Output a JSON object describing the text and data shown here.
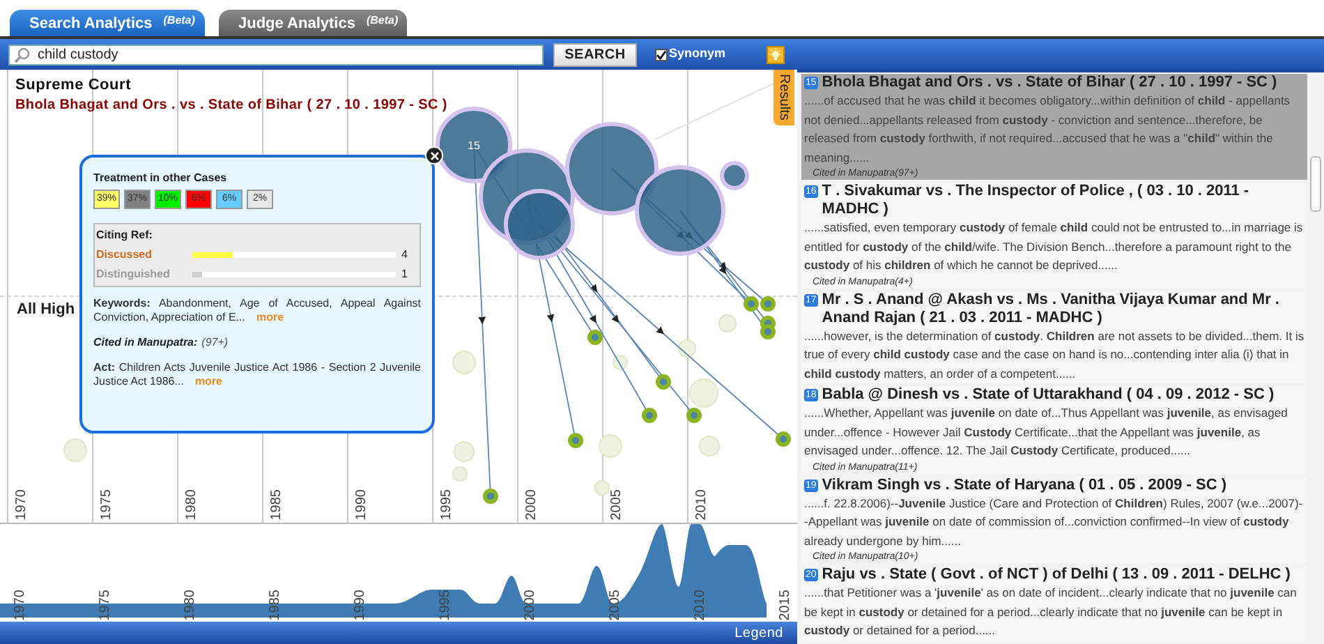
{
  "tabs": [
    {
      "label": "Search Analytics",
      "badge": "(Beta)",
      "selected": true
    },
    {
      "label": "Judge Analytics",
      "badge": "(Beta)",
      "selected": false
    }
  ],
  "search": {
    "value": "child custody",
    "button": "SEARCH",
    "synonym": {
      "label": "Synonym",
      "checked": true
    }
  },
  "chart": {
    "court": "Supreme Court",
    "case_title": "Bhola Bhagat and Ors . vs . State of Bihar ( 27 . 10 . 1997 - SC )",
    "lower_court": "All High",
    "bubble_label": "15",
    "years": [
      "1970",
      "1975",
      "1980",
      "1985",
      "1990",
      "1995",
      "2000",
      "2005",
      "2010"
    ],
    "results_tab": "Results"
  },
  "popup": {
    "treatment_title": "Treatment in other Cases",
    "treatments": [
      {
        "label": "39%",
        "color": "#ffff66"
      },
      {
        "label": "37%",
        "color": "#808080"
      },
      {
        "label": "10%",
        "color": "#00ee00"
      },
      {
        "label": "6%",
        "color": "#ff0000"
      },
      {
        "label": "6%",
        "color": "#66ccff"
      },
      {
        "label": "2%",
        "color": "#e6e6e6"
      }
    ],
    "citing_title": "Citing Ref:",
    "citing": [
      {
        "label": "Discussed",
        "level": 0.2,
        "count": "4",
        "color": "#ffff44"
      },
      {
        "label": "Distinguished",
        "level": 0.05,
        "count": "1",
        "color": "#d0d0d0"
      }
    ],
    "keywords": "**Keywords:** Abandonment, Age of Accused, Appeal Against Conviction, Appreciation of E...",
    "keywords_more": "more",
    "cited": "Cited in Manupatra:",
    "cited_count": "(97+)",
    "act": "**Act:** Children Acts Juvenile Justice Act 1986 - Section 2 Juvenile Justice Act 1986...",
    "act_more": "more"
  },
  "overview": {
    "years": [
      "1970",
      "1975",
      "1980",
      "1985",
      "1990",
      "1995",
      "2000",
      "2005",
      "2010",
      "2015"
    ],
    "legend": "Legend"
  },
  "results": [
    {
      "number": "15",
      "title": "Bhola Bhagat and Ors . vs . State of Bihar ( 27 . 10 . 1997 - SC )",
      "snippet": "......of accused that he was **child** it becomes obligatory...within definition of **child** - appellants not denied...appellants released from **custody** - conviction and sentence...therefore, be released from **custody** forthwith, if not required...accused that he was a \"**child**\" within the meaning......",
      "cited": "Cited in Manupatra(97+)",
      "selected": true
    },
    {
      "number": "16",
      "title": "T . Sivakumar vs . The Inspector of Police , ( 03 . 10 . 2011 - MADHC )",
      "snippet": "......satisfied, even temporary **custody** of female **child** could not be entrusted to...in marriage is entitled for **custody** of the **child**/wife. The Division Bench...therefore a paramount right to the **custody** of his **children** of which he cannot be deprived......",
      "cited": "Cited in Manupatra(4+)",
      "selected": false
    },
    {
      "number": "17",
      "title": "Mr . S . Anand @ Akash vs . Ms . Vanitha Vijaya Kumar and Mr . Anand Rajan ( 21 . 03 . 2011 - MADHC )",
      "snippet": "......however, is the determination of **custody**. **Children** are not assets to be divided...them. It is true of every **child custody** case and the case on hand is no...contending inter alia (i) that in **child custody** matters, an order of a competent......",
      "selected": false
    },
    {
      "number": "18",
      "title": "Babla @ Dinesh vs . State of Uttarakhand ( 04 . 09 . 2012 - SC )",
      "snippet": "......Whether, Appellant was **juvenile** on date of...Thus Appellant was **juvenile**, as envisaged under...offence - However Jail **Custody** Certificate...that the Appellant was **juvenile**, as envisaged under...offence. 12. The Jail **Custody** Certificate, produced......",
      "cited": "Cited in Manupatra(11+)",
      "selected": false
    },
    {
      "number": "19",
      "title": "Vikram Singh vs . State of Haryana ( 01 . 05 . 2009 - SC )",
      "snippet": "......f. 22.8.2006)--**Juvenile** Justice (Care and Protection of **Children**) Rules, 2007 (w.e...2007)--Appellant was **juvenile** on date of commission of...conviction confirmed--In view of **custody** already undergone by him......",
      "cited": "Cited in Manupatra(10+)",
      "selected": false
    },
    {
      "number": "20",
      "title": "Raju vs . State ( Govt . of NCT ) of Delhi ( 13 . 09 . 2011 - DELHC )",
      "snippet": "......that Petitioner was a '**juvenile**' as on date of incident...clearly indicate that no **juvenile** can be kept in **custody** or detained for a period...clearly indicate that no **juvenile** can be kept in **custody** or detained for a period......",
      "selected": false
    }
  ]
}
